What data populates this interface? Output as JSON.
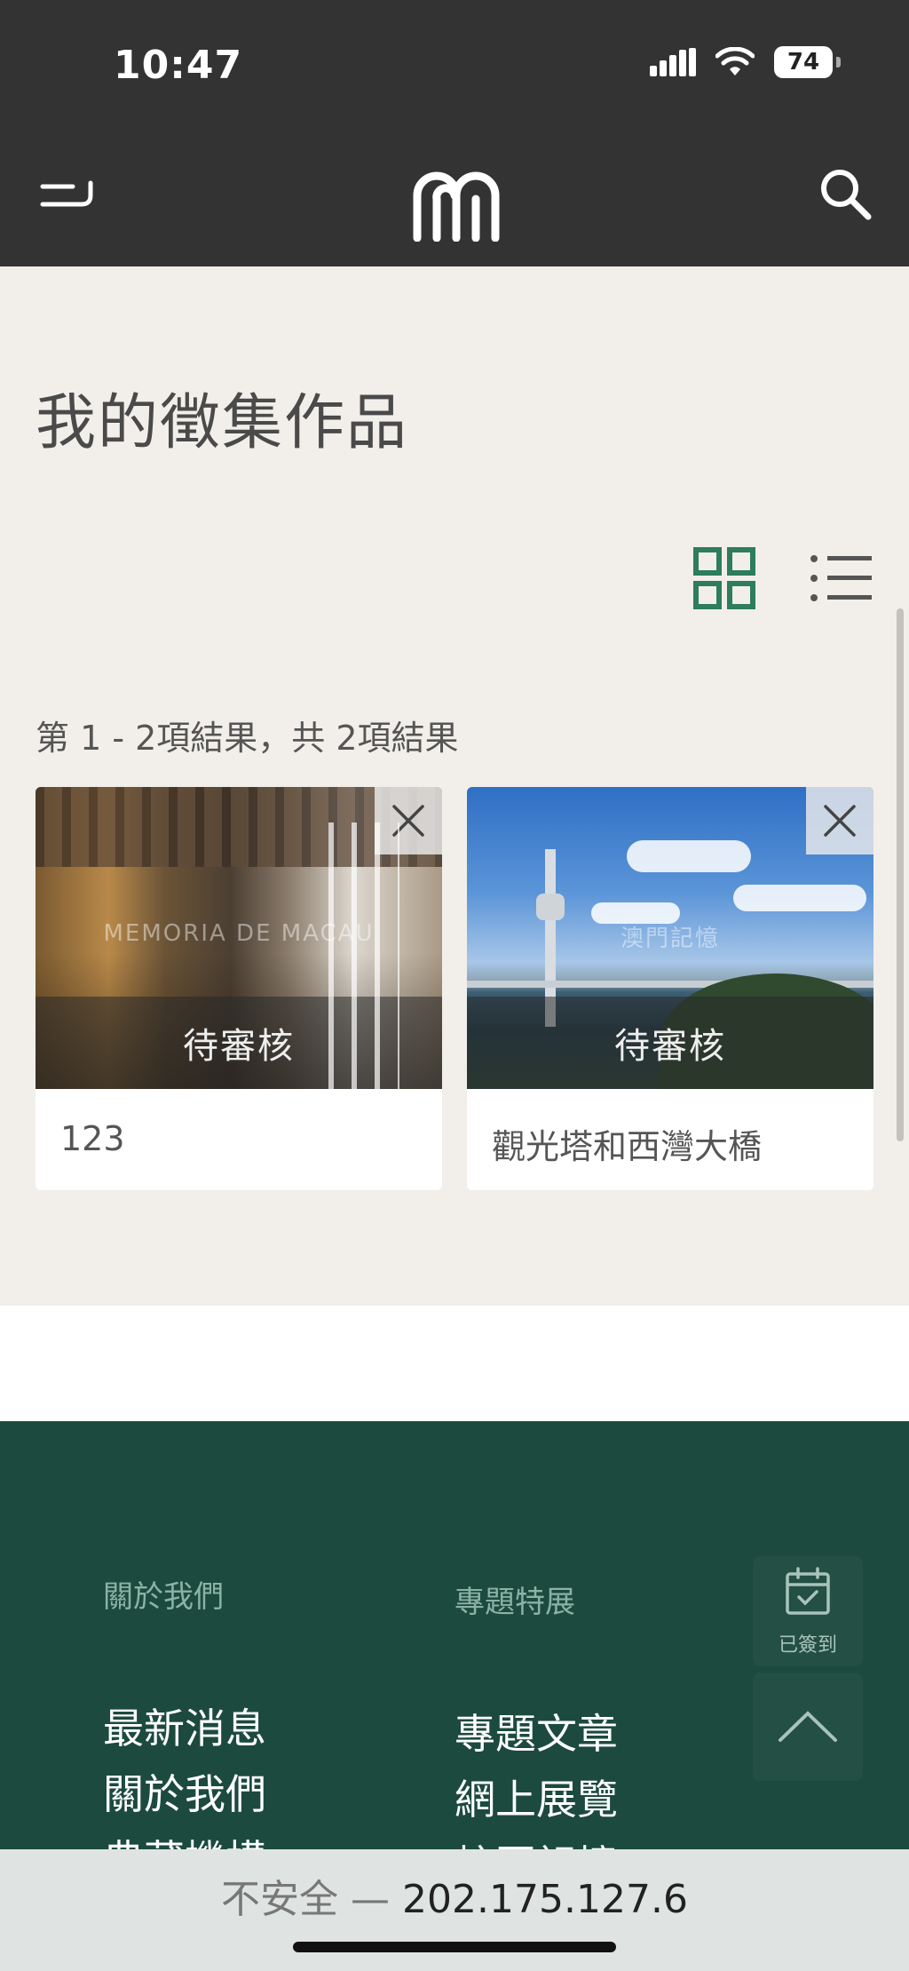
{
  "status_bar": {
    "time": "10:47",
    "battery": "74",
    "icons": [
      "signal-icon",
      "wifi-icon",
      "battery-icon"
    ]
  },
  "header": {
    "icons": [
      "menu-icon",
      "logo-icon",
      "search-icon"
    ]
  },
  "main": {
    "title": "我的徵集作品",
    "view_toggle": {
      "active": "grid",
      "icons": [
        "grid-view-icon",
        "list-view-icon"
      ]
    },
    "result_count": "第 1 - 2項結果，共 2項結果",
    "cards": [
      {
        "title": "123",
        "status": "待審核",
        "watermark": "MEMORIA DE MACAU"
      },
      {
        "title": "觀光塔和西灣大橋",
        "status": "待審核",
        "watermark": "澳門記憶"
      }
    ]
  },
  "footer": {
    "columns": [
      {
        "heading": "關於我們",
        "links": [
          "最新消息",
          "關於我們",
          "典藏機構"
        ]
      },
      {
        "heading": "專題特展",
        "links": [
          "專題文章",
          "網上展覽",
          "校園記憶"
        ]
      }
    ],
    "checkin_label": "已簽到"
  },
  "url_bar": {
    "insecure_label": "不安全",
    "separator": "—",
    "address": "202.175.127.6"
  },
  "colors": {
    "header_bg": "#333333",
    "page_bg": "#f2efea",
    "footer_bg": "#1c4a3e",
    "accent_green": "#2e7d5b"
  }
}
